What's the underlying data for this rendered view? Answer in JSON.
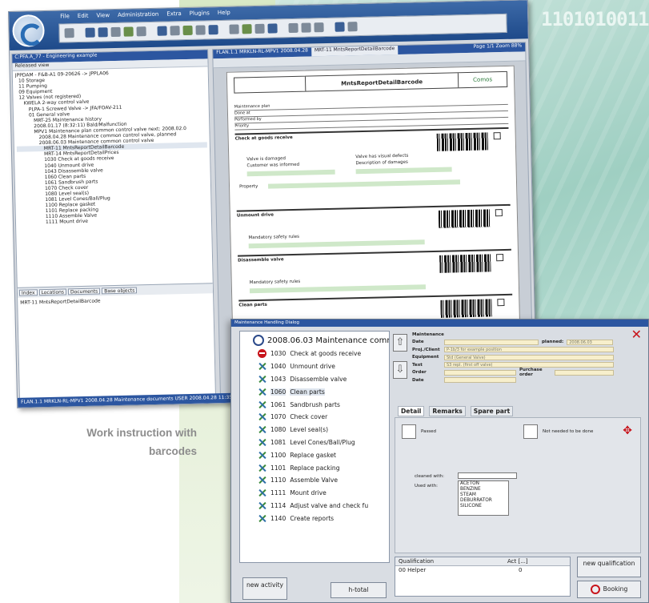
{
  "background": {
    "binary_text": "1101010011O"
  },
  "caption": {
    "line1": "Work instruction with",
    "line2": "barcodes"
  },
  "main_window": {
    "menu": [
      "File",
      "Edit",
      "View",
      "Administration",
      "Extra",
      "Plugins",
      "Help"
    ],
    "left_pane": {
      "header": "C:PFA.A_77 - Engineering example",
      "subheader": "Released view",
      "tree": [
        "JPPDAM - F&B-A1 09-20626 -> JPPLA06",
        "10  Storage",
        "11  Pumping",
        "09  Equipment",
        "12  Valves (not registered)",
        "KWELA  2-way control valve",
        "PLPA-1  Screwed Valve -> JFA/FOAV-211",
        "01  General valve",
        "MRT-25  Maintenance history",
        "2008.01.17 (8:32:11) Bald/Malfunction",
        "MPV1  Maintenance plan common control valve   next: 2008.02.0",
        "2008.04.28 Maintenance common control valve, planned",
        "2008.06.03 Maintenance common control valve",
        "MRT-11  MntsReportDetailBarcode",
        "MRT-14  MntsReportDetailPrices",
        "1030  Check at goods receive",
        "1040  Unmount drive",
        "1043  Disassemble valve",
        "1060  Clean parts",
        "1061  Sandbrush parts",
        "1070  Check cover",
        "1080  Level seal(s)",
        "1081  Level Cones/Ball/Plug",
        "1100  Replace gasket",
        "1101  Replace packing",
        "1110  Assemble Valve",
        "1111  Mount drive"
      ],
      "tabs": [
        "Index",
        "Locations",
        "Documents",
        "Base objects"
      ],
      "object": "MRT-11  MntsReportDetailBarcode"
    },
    "right_pane": {
      "tabs": [
        "FLAN.1.1 MRKLN-RL-MPV1 2008.04.28",
        "MRT-11  MntsReportDetailBarcode"
      ],
      "page_info": "Page  1/1   Zoom  88%",
      "doc": {
        "title": "MntsReportDetailBarcode",
        "logo_text": "Comos",
        "info_rows": [
          "Maintenance plan",
          "Done at",
          "Performed by",
          "Priority"
        ],
        "sections": [
          "Check at goods receive",
          "Unmount drive",
          "Disassemble valve",
          "Clean parts"
        ],
        "section_fields": [
          "Valve is damaged",
          "Customer was informed",
          "Property",
          "Valve has visual defects",
          "Description of damages",
          "Mandatory safety rules"
        ]
      }
    },
    "status": "FLAN.1.1 MRKLN-RL-MPV1 2008.04.28  Maintenance documents  USER  2008.04.28 11:35"
  },
  "dialog": {
    "title": "Maintenance Handling Dialog",
    "close_icon": "close-x",
    "tree_root": "2008.06.03 Maintenance common c",
    "activities": [
      {
        "code": "1030",
        "label": "Check at goods receive",
        "icon": "stop-icon"
      },
      {
        "code": "1040",
        "label": "Unmount drive",
        "icon": "tools-icon"
      },
      {
        "code": "1043",
        "label": "Disassemble valve",
        "icon": "tools-icon"
      },
      {
        "code": "1060",
        "label": "Clean parts",
        "icon": "tools-icon"
      },
      {
        "code": "1061",
        "label": "Sandbrush parts",
        "icon": "tools-icon"
      },
      {
        "code": "1070",
        "label": "Check cover",
        "icon": "tools-icon"
      },
      {
        "code": "1080",
        "label": "Level seal(s)",
        "icon": "tools-icon"
      },
      {
        "code": "1081",
        "label": "Level Cones/Ball/Plug",
        "icon": "tools-icon"
      },
      {
        "code": "1100",
        "label": "Replace gasket",
        "icon": "tools-icon"
      },
      {
        "code": "1101",
        "label": "Replace packing",
        "icon": "tools-icon"
      },
      {
        "code": "1110",
        "label": "Assemble Valve",
        "icon": "tools-icon"
      },
      {
        "code": "1111",
        "label": "Mount drive",
        "icon": "tools-icon"
      },
      {
        "code": "1114",
        "label": "Adjust valve and check fu",
        "icon": "tools-icon"
      },
      {
        "code": "1140",
        "label": "Create reports",
        "icon": "tools-icon"
      }
    ],
    "form": {
      "header": "Maintenance",
      "date_label": "Date",
      "planned_label": "planned:",
      "planned_value": "2008.06.03",
      "proj_label": "Proj./Client",
      "proj_value": "P-1b/3 for example position",
      "equipment_label": "Equipment",
      "equipment_value": "Std (General Valve)",
      "text_label": "Text",
      "text_value": "S3 repl. (first off valve)",
      "order_label": "Order",
      "purchase_label": "Purchase order",
      "date2_label": "Date"
    },
    "tabs": [
      "Detail",
      "Remarks",
      "Spare part"
    ],
    "detail": {
      "passed_label": "Passed",
      "not_needed_label": "Not needed to be done",
      "cleaned_with_label": "cleaned with:",
      "used_with_label": "Used with:",
      "cleaning_options": [
        "ACETON",
        "BENZINE",
        "STEAM",
        "DEBURRATOR",
        "SILICONE"
      ]
    },
    "qualification": {
      "headers": [
        "Qualification",
        "Act [...]"
      ],
      "rows": [
        {
          "name": "00 Helper",
          "value": "0"
        }
      ]
    },
    "buttons": {
      "new_qualification": "new qualification",
      "booking": "Booking",
      "new_activity": "new activity",
      "h_total": "h-total"
    }
  }
}
